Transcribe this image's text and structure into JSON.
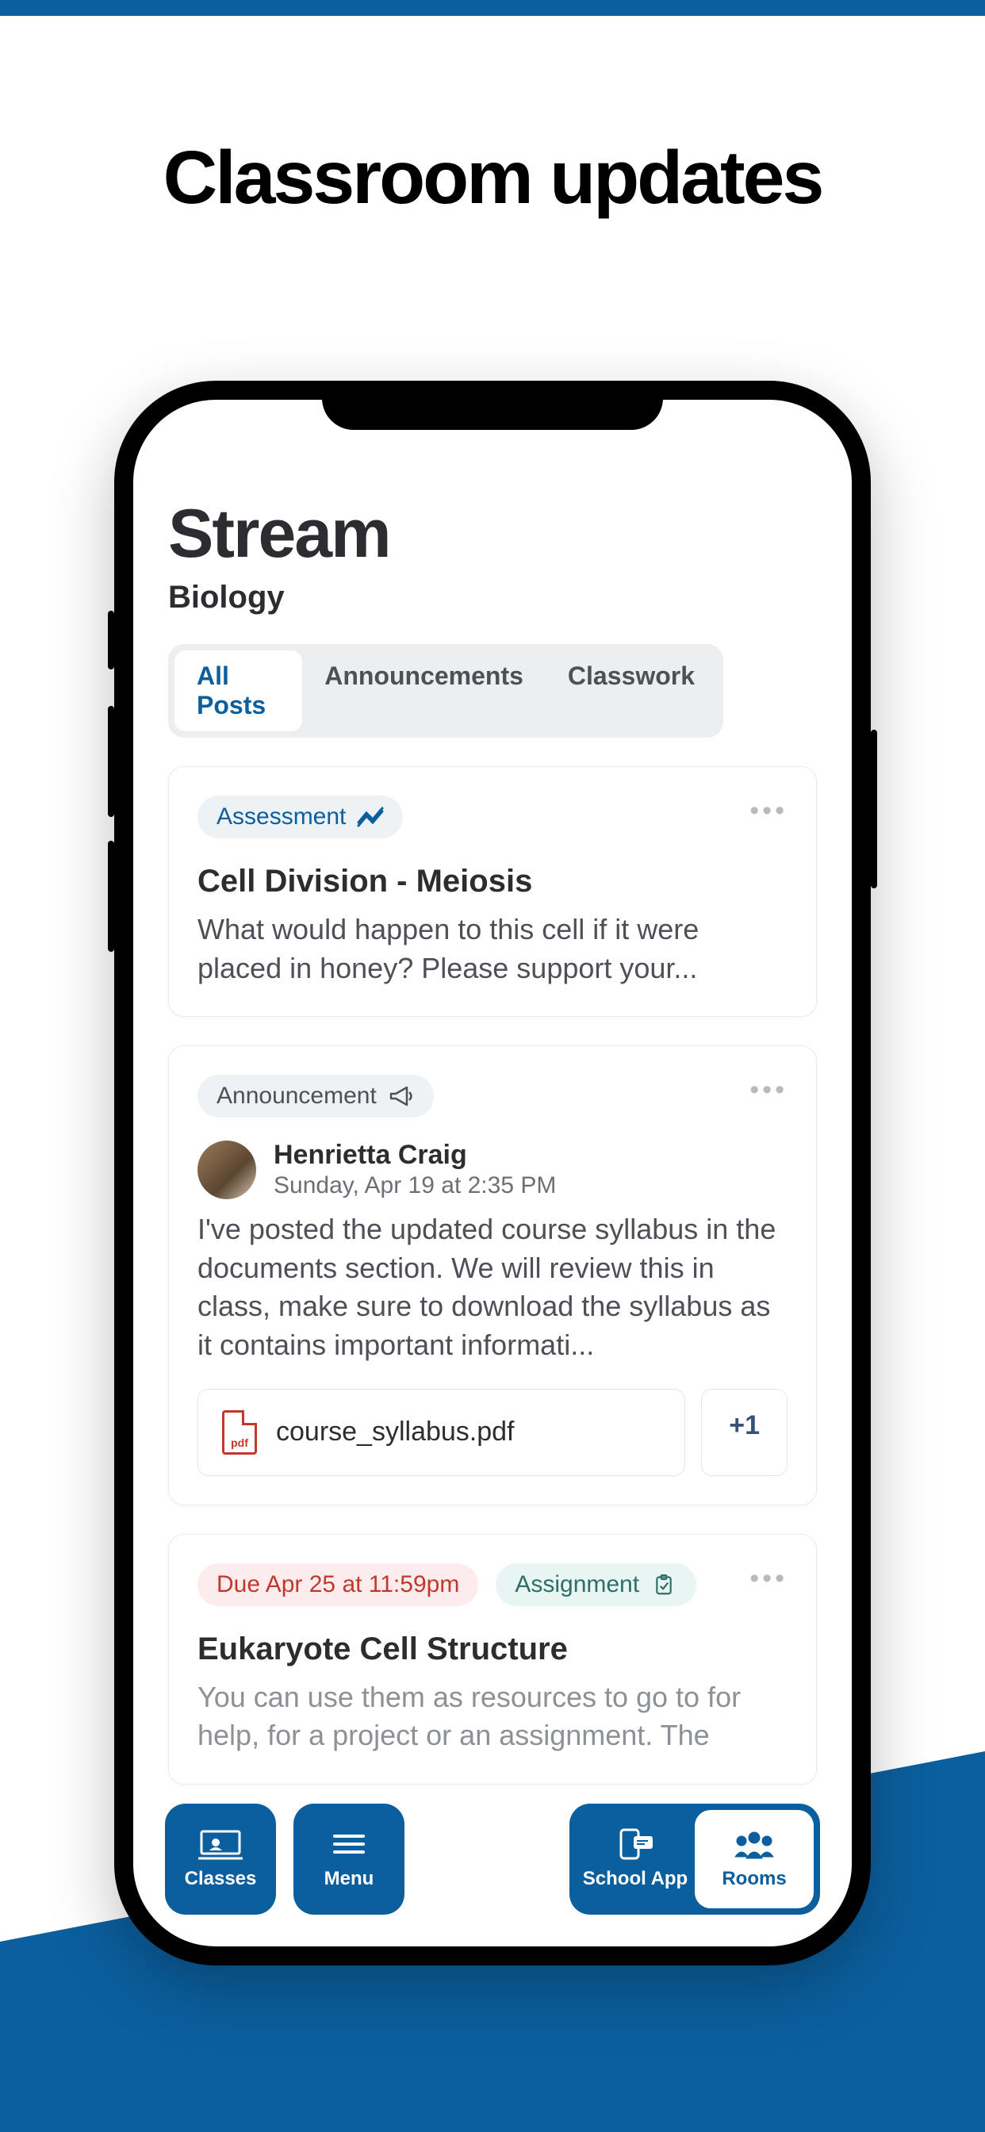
{
  "promo": {
    "title": "Classroom updates"
  },
  "screen": {
    "title": "Stream",
    "subject": "Biology",
    "tabs": [
      {
        "label": "All Posts",
        "active": true
      },
      {
        "label": "Announcements",
        "active": false
      },
      {
        "label": "Classwork",
        "active": false
      }
    ],
    "posts": [
      {
        "type_label": "Assessment",
        "title": "Cell Division - Meiosis",
        "body": "What would happen to this cell if it were placed in honey? Please support your..."
      },
      {
        "type_label": "Announcement",
        "author": {
          "name": "Henrietta Craig",
          "time": "Sunday, Apr 19 at 2:35 PM"
        },
        "body": "I've posted the updated course syllabus in the documents section. We will review this in class, make sure to download the syllabus as it contains important informati...",
        "attachment": {
          "filename": "course_syllabus.pdf",
          "more_label": "+1"
        }
      },
      {
        "due_label": "Due Apr 25 at 11:59pm",
        "type_label": "Assignment",
        "title": "Eukaryote Cell Structure",
        "body": "You can use them as resources to go to for help, for a project or an assignment. The"
      }
    ]
  },
  "nav": {
    "classes": "Classes",
    "menu": "Menu",
    "schoolapp": "School App",
    "rooms": "Rooms"
  }
}
